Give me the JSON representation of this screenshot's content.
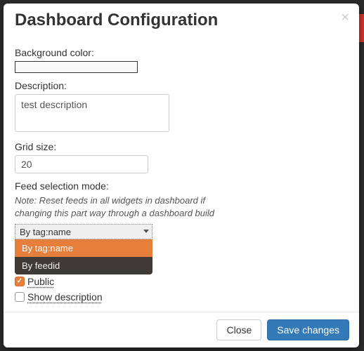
{
  "modal": {
    "title": "Dashboard Configuration",
    "close_symbol": "×"
  },
  "form": {
    "bg_color": {
      "label": "Background color:"
    },
    "description": {
      "label": "Description:",
      "value": "test description"
    },
    "grid_size": {
      "label": "Grid size:",
      "value": "20"
    },
    "feed_mode": {
      "label": "Feed selection mode:",
      "note": "Note: Reset feeds in all widgets in dashboard if changing this part way through a dashboard build",
      "selected": "By tag:name",
      "options": [
        "By tag:name",
        "By feedid"
      ]
    },
    "checkboxes": {
      "public": {
        "label": "Public",
        "checked": true
      },
      "show_description": {
        "label": "Show description",
        "checked": false
      }
    }
  },
  "footer": {
    "close": "Close",
    "save": "Save changes"
  }
}
